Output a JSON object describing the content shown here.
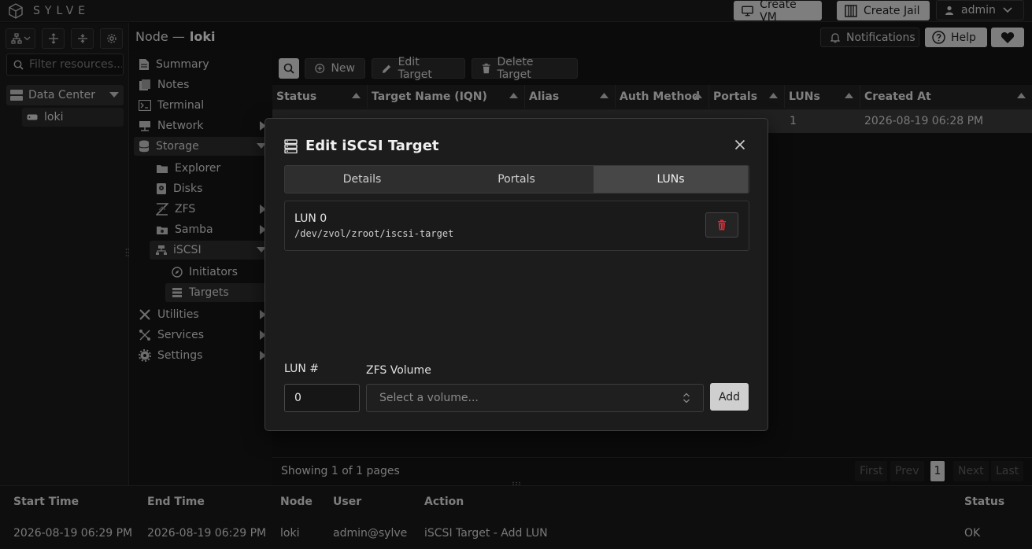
{
  "app": {
    "name": "SYLVE"
  },
  "header": {
    "create_vm": "Create VM",
    "create_jail": "Create Jail",
    "user": "admin"
  },
  "page": {
    "title_prefix": "Node —",
    "title_node": "loki",
    "notifications": "Notifications",
    "help": "Help"
  },
  "resources": {
    "filter_placeholder": "Filter resources...",
    "datacenter": "Data Center",
    "node": "loki"
  },
  "nav": {
    "summary": "Summary",
    "notes": "Notes",
    "terminal": "Terminal",
    "network": "Network",
    "storage": "Storage",
    "explorer": "Explorer",
    "disks": "Disks",
    "zfs": "ZFS",
    "samba": "Samba",
    "iscsi": "iSCSI",
    "initiators": "Initiators",
    "targets": "Targets",
    "utilities": "Utilities",
    "services": "Services",
    "settings": "Settings"
  },
  "toolbar": {
    "new": "New",
    "edit": "Edit Target",
    "delete": "Delete Target"
  },
  "table": {
    "columns": [
      "Status",
      "Target Name (IQN)",
      "Alias",
      "Auth Method",
      "Portals",
      "LUNs",
      "Created At"
    ],
    "row": {
      "luns": "1",
      "created": "2026-08-19 06:28 PM"
    }
  },
  "pagination": {
    "info": "Showing 1 of 1 pages",
    "first": "First",
    "prev": "Prev",
    "current": "1",
    "next": "Next",
    "last": "Last"
  },
  "tasklog": {
    "headers": [
      "Start Time",
      "End Time",
      "Node",
      "User",
      "Action",
      "Status"
    ],
    "row": [
      "2026-08-19 06:29 PM",
      "2026-08-19 06:29 PM",
      "loki",
      "admin@sylve",
      "iSCSI Target - Add LUN",
      "OK"
    ]
  },
  "modal": {
    "title": "Edit iSCSI Target",
    "tabs": [
      "Details",
      "Portals",
      "LUNs"
    ],
    "active_tab": "LUNs",
    "lun": {
      "name": "LUN 0",
      "path": "/dev/zvol/zroot/iscsi-target"
    },
    "lun_label": "LUN #",
    "lun_value": "0",
    "volume_label": "ZFS Volume",
    "volume_placeholder": "Select a volume...",
    "add": "Add"
  },
  "colors": {
    "danger": "#d92d3a",
    "accent": "#dadada"
  }
}
